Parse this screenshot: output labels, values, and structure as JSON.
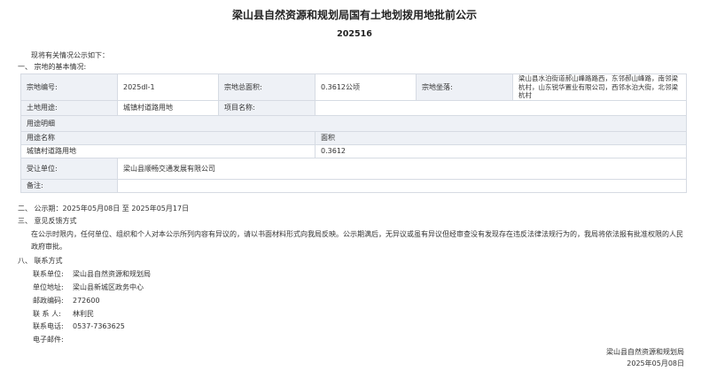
{
  "title": "梁山县自然资源和规划局国有土地划拨用地批前公示",
  "number": "202516",
  "intro": "现将有关情况公示如下：",
  "section1_heading": "一、 宗地的基本情况:",
  "table": {
    "parcel_no_label": "宗地编号:",
    "parcel_no": "2025dl-1",
    "total_area_label": "宗地总面积:",
    "total_area": "0.3612公顷",
    "location_label": "宗地坐落:",
    "location": "梁山县水泊街道郝山峰路路西，东邻郝山峰路，南邻梁杭村，山东锐华置业有限公司，西邻水泊大街，北邻梁杭村",
    "land_use_label": "土地用途:",
    "land_use": "城镇村道路用地",
    "project_name_label": "项目名称:",
    "project_name": "",
    "use_detail_label": "用途明细",
    "use_name_header": "用途名称",
    "use_area_header": "面积",
    "use_rows": [
      {
        "name": "城镇村道路用地",
        "area": "0.3612"
      }
    ],
    "transferee_label": "受让单位:",
    "transferee": "梁山县顺畅交通发展有限公司",
    "remarks_label": "备注:",
    "remarks": ""
  },
  "section2": "二、 公示期：2025年05月08日 至 2025年05月17日",
  "section3_heading": "三、 意见反馈方式",
  "section3_body": "在公示时限内，任何单位、组织和个人对本公示所列内容有异议的，请以书面材料形式向我局反映。公示期满后，无异议或虽有异议但经审查没有发现存在违反法律法规行为的，我局将依法报有批准权限的人民政府审批。",
  "section8_heading": "八、 联系方式",
  "contacts": [
    {
      "label": "联系单位:",
      "value": "梁山县自然资源和规划局"
    },
    {
      "label": "单位地址:",
      "value": "梁山县新城区政务中心"
    },
    {
      "label": "邮政编码:",
      "value": "272600"
    },
    {
      "label": "联 系 人:",
      "value": "林利民"
    },
    {
      "label": "联系电话:",
      "value": "0537-7363625"
    },
    {
      "label": "电子邮件:",
      "value": ""
    }
  ],
  "signature_org": "梁山县自然资源和规划局",
  "signature_date": "2025年05月08日"
}
